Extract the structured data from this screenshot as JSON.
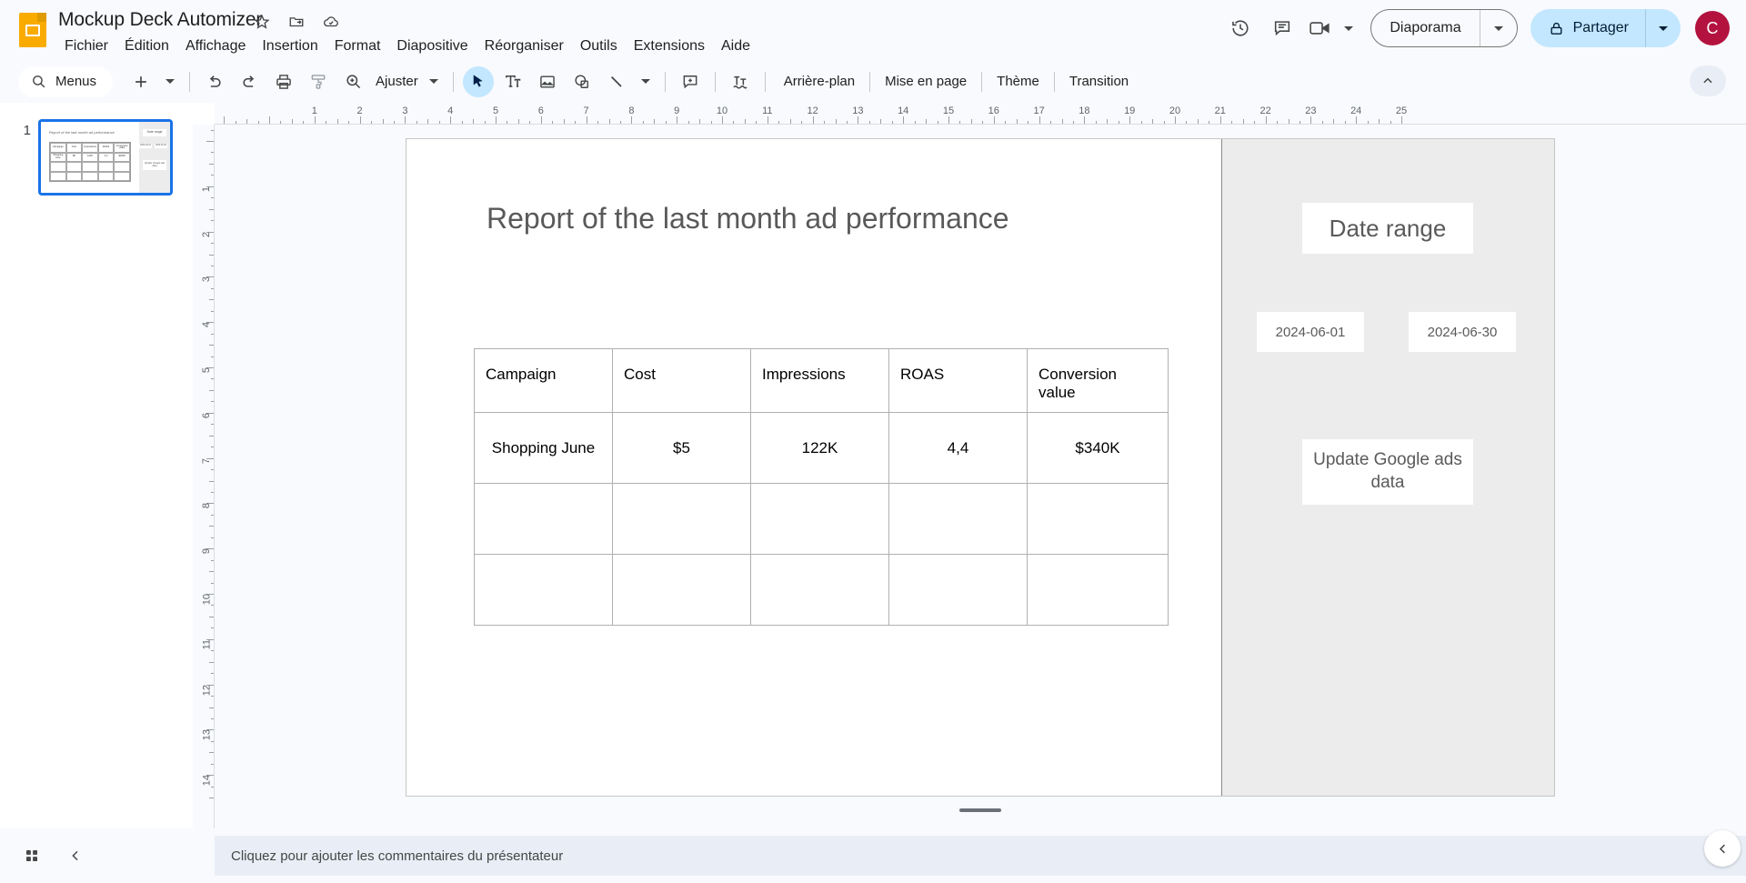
{
  "app": {
    "title": "Mockup Deck Automizer",
    "title_icons": [
      "star-icon",
      "move-to-folder-icon",
      "cloud-saved-icon"
    ],
    "menus": [
      "Fichier",
      "Édition",
      "Affichage",
      "Insertion",
      "Format",
      "Diapositive",
      "Réorganiser",
      "Outils",
      "Extensions",
      "Aide"
    ],
    "accent_color": "#1a73e8",
    "brand_color": "#f9ab00",
    "share_bg_color": "#c2e7ff",
    "avatar_color": "#b3123f"
  },
  "topright": {
    "history_icon": "version-history-icon",
    "comment_icon": "comment-icon",
    "meet_icon": "meet-camera-icon",
    "present_label": "Diaporama",
    "share_label": "Partager",
    "avatar_initial": "C"
  },
  "toolbar": {
    "menus_label": "Menus",
    "search_icon": "search-icon",
    "add_icon": "new-slide-icon",
    "undo_icon": "undo-icon",
    "redo_icon": "redo-icon",
    "print_icon": "print-icon",
    "paint_icon": "paint-format-icon",
    "zoom_icon": "zoom-icon",
    "fit_label": "Ajuster",
    "select_icon": "select-cursor-icon",
    "textbox_icon": "text-box-icon",
    "image_icon": "insert-image-icon",
    "shape_icon": "insert-shape-icon",
    "line_icon": "insert-line-icon",
    "comment_icon": "add-comment-icon",
    "transform_icon": "text-transform-icon",
    "background_label": "Arrière-plan",
    "layout_label": "Mise en page",
    "theme_label": "Thème",
    "transition_label": "Transition",
    "collapse_icon": "chevron-up-icon"
  },
  "rulers": {
    "horizontal_ticks": [
      1,
      2,
      3,
      4,
      5,
      6,
      7,
      8,
      9,
      10,
      11,
      12,
      13,
      14,
      15,
      16,
      17,
      18,
      19,
      20,
      21,
      22,
      23,
      24,
      25
    ],
    "vertical_ticks": [
      1,
      2,
      3,
      4,
      5,
      6,
      7,
      8,
      9,
      10,
      11,
      12,
      13,
      14
    ]
  },
  "thumbnails": {
    "items": [
      {
        "number": "1",
        "title": "Report of the last month ad performance"
      }
    ]
  },
  "slide": {
    "title": "Report of the last month ad performance",
    "table": {
      "headers": [
        "Campaign",
        "Cost",
        "Impressions",
        "ROAS",
        "Conversion value"
      ],
      "rows": [
        [
          "Shopping June",
          "$5",
          "122K",
          "4,4",
          "$340K"
        ],
        [
          "",
          "",
          "",
          "",
          ""
        ],
        [
          "",
          "",
          "",
          "",
          ""
        ]
      ]
    },
    "side_panel": {
      "date_range_label": "Date range",
      "date_start": "2024-06-01",
      "date_end": "2024-06-30",
      "update_button": "Update Google ads data"
    }
  },
  "bottom": {
    "grid_icon": "grid-view-icon",
    "collapse_icon": "chevron-left-icon",
    "notes_placeholder": "Cliquez pour ajouter les commentaires du présentateur",
    "expand_icon": "chevron-left-icon"
  }
}
